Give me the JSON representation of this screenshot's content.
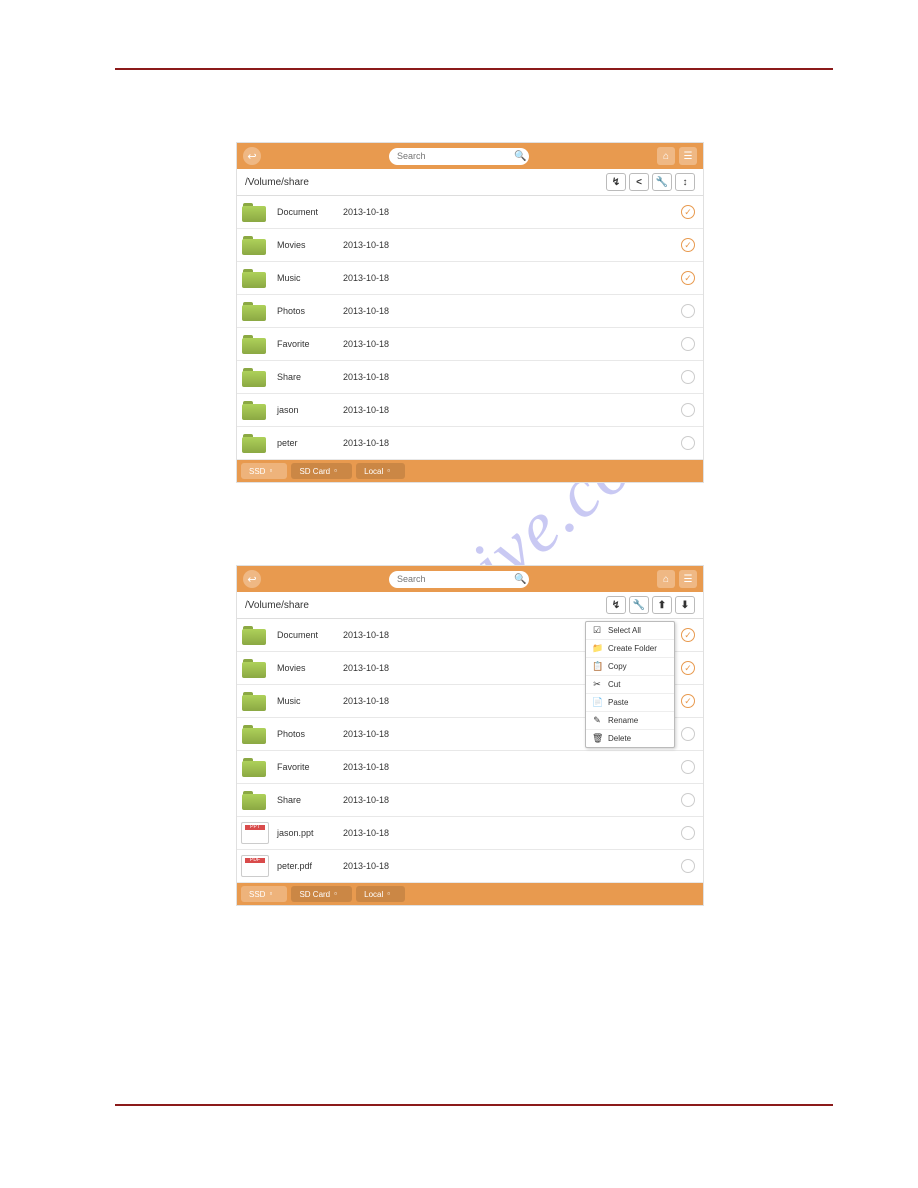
{
  "watermark": "manualshive.com",
  "search_placeholder": "Search",
  "path": "/Volume/share",
  "date": "2013-10-18",
  "tabs": {
    "ssd": "SSD",
    "sdcard": "SD Card",
    "local": "Local"
  },
  "app1": {
    "files": [
      {
        "name": "Document",
        "type": "folder",
        "checked": true
      },
      {
        "name": "Movies",
        "type": "folder",
        "checked": true
      },
      {
        "name": "Music",
        "type": "folder",
        "checked": true
      },
      {
        "name": "Photos",
        "type": "folder",
        "checked": false
      },
      {
        "name": "Favorite",
        "type": "folder",
        "checked": false
      },
      {
        "name": "Share",
        "type": "folder",
        "checked": false
      },
      {
        "name": "jason",
        "type": "folder",
        "checked": false
      },
      {
        "name": "peter",
        "type": "folder",
        "checked": false
      }
    ]
  },
  "app2": {
    "files": [
      {
        "name": "Document",
        "type": "folder",
        "checked": true
      },
      {
        "name": "Movies",
        "type": "folder",
        "checked": true
      },
      {
        "name": "Music",
        "type": "folder",
        "checked": true
      },
      {
        "name": "Photos",
        "type": "folder",
        "checked": false
      },
      {
        "name": "Favorite",
        "type": "folder",
        "checked": false
      },
      {
        "name": "Share",
        "type": "folder",
        "checked": false
      },
      {
        "name": "jason.ppt",
        "type": "file",
        "checked": false
      },
      {
        "name": "peter.pdf",
        "type": "file",
        "checked": false
      }
    ],
    "menu": [
      {
        "icon": "☑",
        "label": "Select All"
      },
      {
        "icon": "📁",
        "label": "Create Folder"
      },
      {
        "icon": "📋",
        "label": "Copy"
      },
      {
        "icon": "✂",
        "label": "Cut"
      },
      {
        "icon": "📄",
        "label": "Paste"
      },
      {
        "icon": "✎",
        "label": "Rename"
      },
      {
        "icon": "🗑",
        "label": "Delete"
      }
    ]
  }
}
